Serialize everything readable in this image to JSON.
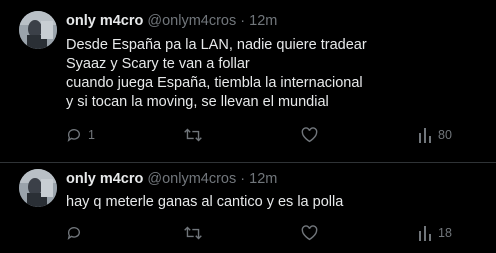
{
  "tweets": [
    {
      "author": {
        "name": "only m4cro",
        "handle": "@onlym4cros",
        "separator": "·",
        "time": "12m"
      },
      "lines": [
        "Desde España pa la LAN, nadie quiere tradear",
        "Syaaz y Scary te van a follar",
        "cuando juega España, tiembla la internacional",
        "y si tocan la moving, se llevan el mundial"
      ],
      "actions": {
        "reply_count": "1",
        "retweet_count": "",
        "like_count": "",
        "view_count": "80"
      },
      "icons": [
        "reply-icon",
        "retweet-icon",
        "like-icon",
        "views-icon"
      ]
    },
    {
      "author": {
        "name": "only m4cro",
        "handle": "@onlym4cros",
        "separator": "·",
        "time": "12m"
      },
      "lines": [
        "hay q meterle ganas al cantico y es la polla"
      ],
      "actions": {
        "reply_count": "",
        "retweet_count": "",
        "like_count": "",
        "view_count": "18"
      },
      "icons": [
        "reply-icon",
        "retweet-icon",
        "like-icon",
        "views-icon"
      ]
    }
  ],
  "colors": {
    "background": "#000000",
    "text_primary": "#e7e9ea",
    "text_secondary": "#71767b",
    "divider": "#2f3336"
  }
}
